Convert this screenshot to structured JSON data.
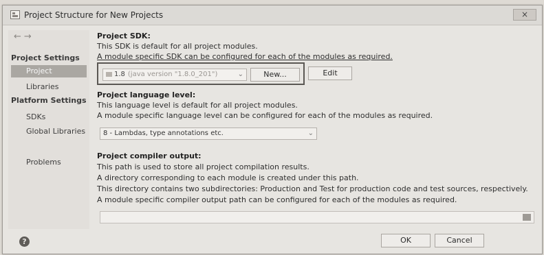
{
  "window": {
    "title": "Project Structure for New Projects",
    "close_glyph": "×"
  },
  "nav": {
    "back": "←",
    "forward": "→"
  },
  "sidebar": {
    "sections": [
      "Project Settings",
      "Platform Settings"
    ],
    "project_settings_items": [
      "Project",
      "Libraries"
    ],
    "platform_settings_items": [
      "SDKs",
      "Global Libraries"
    ],
    "problems": "Problems",
    "selected": "Project"
  },
  "sdk": {
    "heading": "Project SDK:",
    "line1": "This SDK is default for all project modules.",
    "line2": "A module specific SDK can be configured for each of the modules as required.",
    "selected_value": "1.8",
    "selected_version": "(java version \"1.8.0_201\")",
    "new_button": "New...",
    "edit_button": "Edit"
  },
  "language_level": {
    "heading": "Project language level:",
    "line1": "This language level is default for all project modules.",
    "line2": "A module specific language level can be configured for each of the modules as required.",
    "selected_value": "8 - Lambdas, type annotations etc."
  },
  "compiler_output": {
    "heading": "Project compiler output:",
    "line1": "This path is used to store all project compilation results.",
    "line2": "A directory corresponding to each module is created under this path.",
    "line3": "This directory contains two subdirectories: Production and Test for production code and test sources, respectively.",
    "line4": "A module specific compiler output path can be configured for each of the modules as required.",
    "value": ""
  },
  "footer": {
    "help": "?",
    "ok_button": "OK",
    "cancel_button": "Cancel"
  }
}
